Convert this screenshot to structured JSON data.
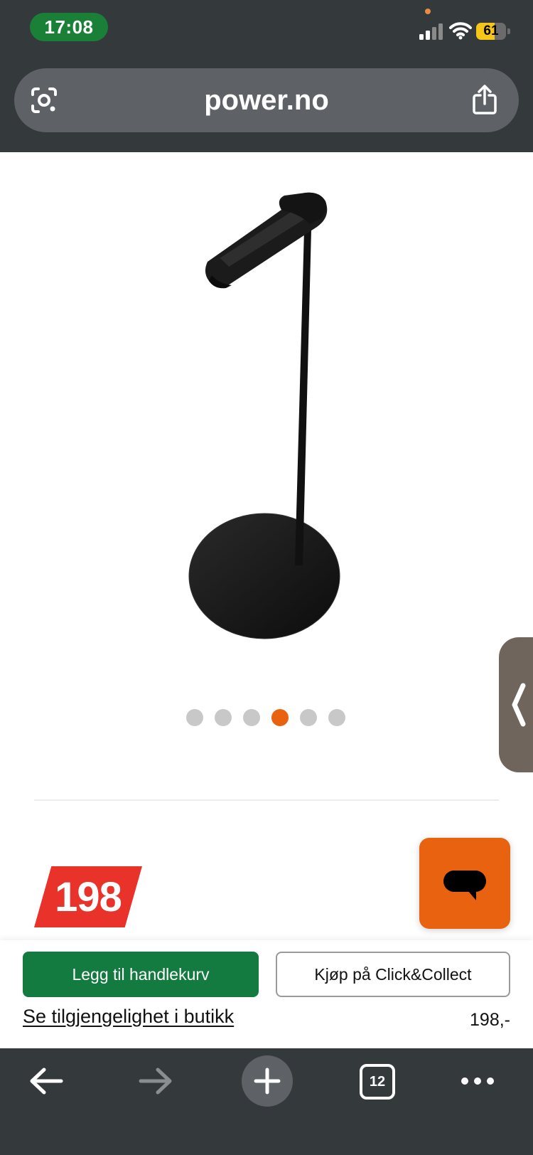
{
  "status_bar": {
    "time": "17:08",
    "battery_level": "61",
    "battery_fraction": 0.61
  },
  "address_bar": {
    "url": "power.no",
    "left_icon": "lens-icon",
    "right_icon": "share-icon"
  },
  "product": {
    "image_description_icon": "headphone-stand-image",
    "carousel": {
      "dot_count": 6,
      "active_index": 3
    },
    "price_badge": "198"
  },
  "actions": {
    "add_to_cart_label": "Legg til handlekurv",
    "click_collect_label": "Kjøp på Click&Collect",
    "availability_link": "Se tilgjengelighet i butikk",
    "price": "198,-"
  },
  "toolbar": {
    "tab_count": "12",
    "icons": [
      "back-arrow-icon",
      "forward-arrow-icon",
      "plus-icon",
      "tabs-icon",
      "more-icon"
    ]
  },
  "colors": {
    "chrome": "#34393b",
    "accent_orange": "#e8620f",
    "cart_green": "#137a40",
    "price_red": "#e8322a",
    "time_green": "#1a7f37",
    "battery_yellow": "#f5c518"
  }
}
